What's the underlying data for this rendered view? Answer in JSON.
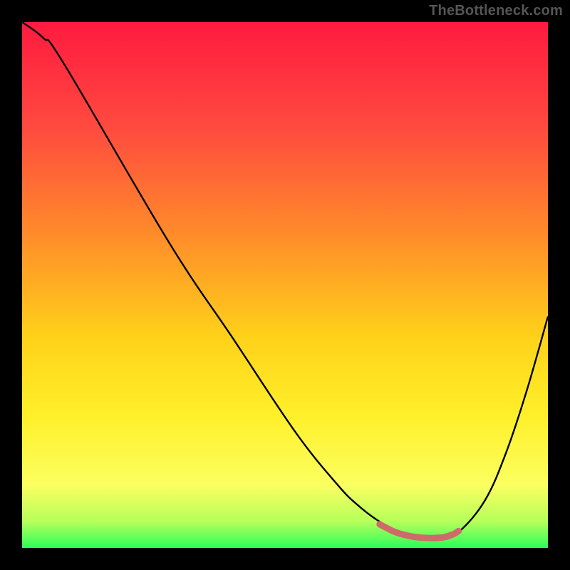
{
  "watermark": "TheBottleneck.com",
  "chart_data": {
    "type": "line",
    "title": "",
    "xlabel": "",
    "ylabel": "",
    "xlim": [
      0,
      100
    ],
    "ylim": [
      0,
      100
    ],
    "grid": false,
    "series": [
      {
        "name": "bottleneck-curve",
        "x": [
          0,
          4,
          8,
          28,
          40,
          52,
          60,
          64,
          68,
          72,
          76,
          80,
          83,
          88,
          92,
          96,
          100
        ],
        "values": [
          100,
          97,
          92,
          58,
          40,
          22,
          12,
          8,
          5,
          3,
          2,
          2,
          3,
          9,
          18,
          30,
          44
        ]
      }
    ],
    "highlight": {
      "name": "optimal-range",
      "x": [
        68,
        71,
        74,
        77,
        80,
        82,
        83
      ],
      "values": [
        4.5,
        3.0,
        2.2,
        1.9,
        2.0,
        2.6,
        3.2
      ]
    },
    "gradient_stops": [
      {
        "offset": 0.0,
        "color": "#ff1a3f"
      },
      {
        "offset": 0.2,
        "color": "#ff4a3f"
      },
      {
        "offset": 0.4,
        "color": "#ff8a2a"
      },
      {
        "offset": 0.6,
        "color": "#ffd21a"
      },
      {
        "offset": 0.75,
        "color": "#fff02a"
      },
      {
        "offset": 0.88,
        "color": "#fbff60"
      },
      {
        "offset": 0.95,
        "color": "#b6ff5a"
      },
      {
        "offset": 1.0,
        "color": "#2cff5a"
      }
    ],
    "curve_color": "#000000",
    "highlight_color": "#cf6a6a"
  }
}
